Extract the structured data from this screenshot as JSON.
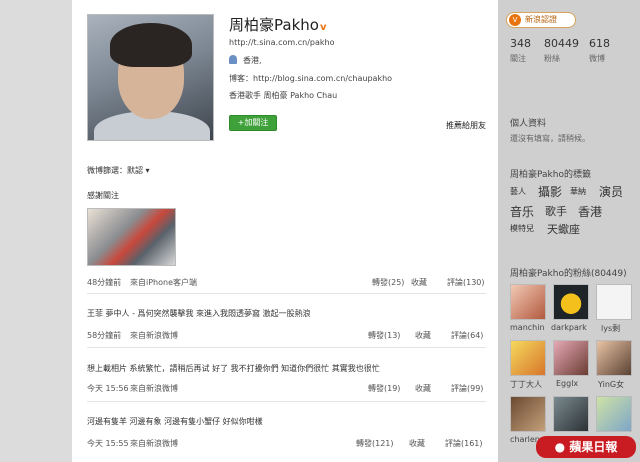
{
  "profile": {
    "name": "周柏豪Pakho",
    "verified_mark": "v",
    "url": "http://t.sina.com.cn/pakho",
    "location": "香港,",
    "blog": "博客：http://blog.sina.com.cn/chaupakho",
    "description": "香港歌手 周柏豪 Pakho Chau",
    "follow_button": "+加關注",
    "recommend_link": "推薦給朋友"
  },
  "feed": {
    "filter_label": "微博篩選：默認",
    "posts": [
      {
        "text": "感謝關注",
        "time": "48分鐘前",
        "source": "來自iPhone客户端",
        "repost": "轉發(25)",
        "favorite": "收藏",
        "comment": "評論(130)"
      },
      {
        "text": "王菲 夢中人 - 爲何突然襲擊我 來進入我悶透夢窩 激起一股熱浪",
        "time": "58分鐘前",
        "source": "來自新浪微博",
        "repost": "轉發(13)",
        "favorite": "收藏",
        "comment": "評論(64)"
      },
      {
        "text": "想上載相片 系統繁忙，請稍后再试 好了 我不打擾你們 知道你們很忙 其實我也很忙",
        "time": "今天 15:56",
        "source": "來自新浪微博",
        "repost": "轉發(19)",
        "favorite": "收藏",
        "comment": "評論(99)"
      },
      {
        "text": "河邊有隻羊 河邊有象 河邊有隻小蟹仔 好似你咁樣",
        "time": "今天 15:55",
        "source": "來自新浪微博",
        "repost": "轉發(121)",
        "favorite": "收藏",
        "comment": "評論(161)"
      }
    ]
  },
  "sidebar": {
    "badge": "新浪認證",
    "stats": [
      {
        "value": "348",
        "label": "關注"
      },
      {
        "value": "80449",
        "label": "粉絲"
      },
      {
        "value": "618",
        "label": "微博"
      }
    ],
    "personal_title": "個人資料",
    "personal_note": "還沒有填寫，請稍候。",
    "tags_title": "周柏豪Pakho的標籤",
    "tags_row1": [
      "藝人",
      "攝影",
      "華納",
      "演员"
    ],
    "tags_row2": [
      "音乐",
      "歌手",
      "香港"
    ],
    "tags_row3": [
      "模特兒",
      "天蠍座"
    ],
    "fans_title": "周柏豪Pakho的粉絲(80449)",
    "fans": [
      "manchin",
      "darkpark",
      "lys剩",
      "丁丁大人",
      "Egglx",
      "YinG女",
      "charlene",
      "",
      ""
    ],
    "logo_text": "蘋果日報"
  }
}
